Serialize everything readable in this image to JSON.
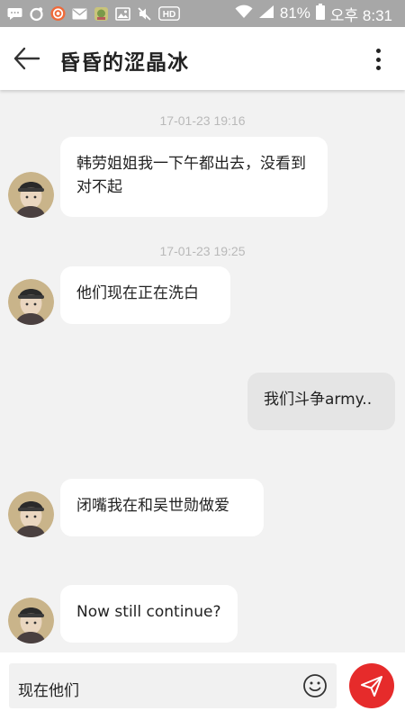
{
  "status_bar": {
    "battery_percent": "81%",
    "time": "오후 8:31",
    "hd_label": "HD",
    "icons": [
      "chat-icon",
      "quick-icon",
      "record-icon",
      "mail-icon",
      "app-icon",
      "gallery-icon",
      "mute-icon",
      "hd-icon",
      "wifi-icon",
      "signal-icon",
      "battery-icon"
    ]
  },
  "header": {
    "title": "昏昏的涩晶冰"
  },
  "messages": [
    {
      "type": "timestamp",
      "text": "17-01-23 19:16"
    },
    {
      "type": "received",
      "text": "韩劳姐姐我一下午都出去，没看到对不起"
    },
    {
      "type": "timestamp",
      "text": "17-01-23 19:25"
    },
    {
      "type": "received",
      "text": "他们现在正在洗白"
    },
    {
      "type": "sent",
      "text": "我们斗争army.."
    },
    {
      "type": "received",
      "text": "闭嘴我在和吴世勋做爱"
    },
    {
      "type": "received",
      "text": "Now still continue?"
    }
  ],
  "composer": {
    "input_value": "现在他们"
  },
  "colors": {
    "status_bar": "#a7a7a7",
    "background": "#f2f2f2",
    "received_bubble": "#ffffff",
    "sent_bubble": "#e5e5e5",
    "send_button": "#e62b2b",
    "timestamp": "#b9b9b9"
  }
}
